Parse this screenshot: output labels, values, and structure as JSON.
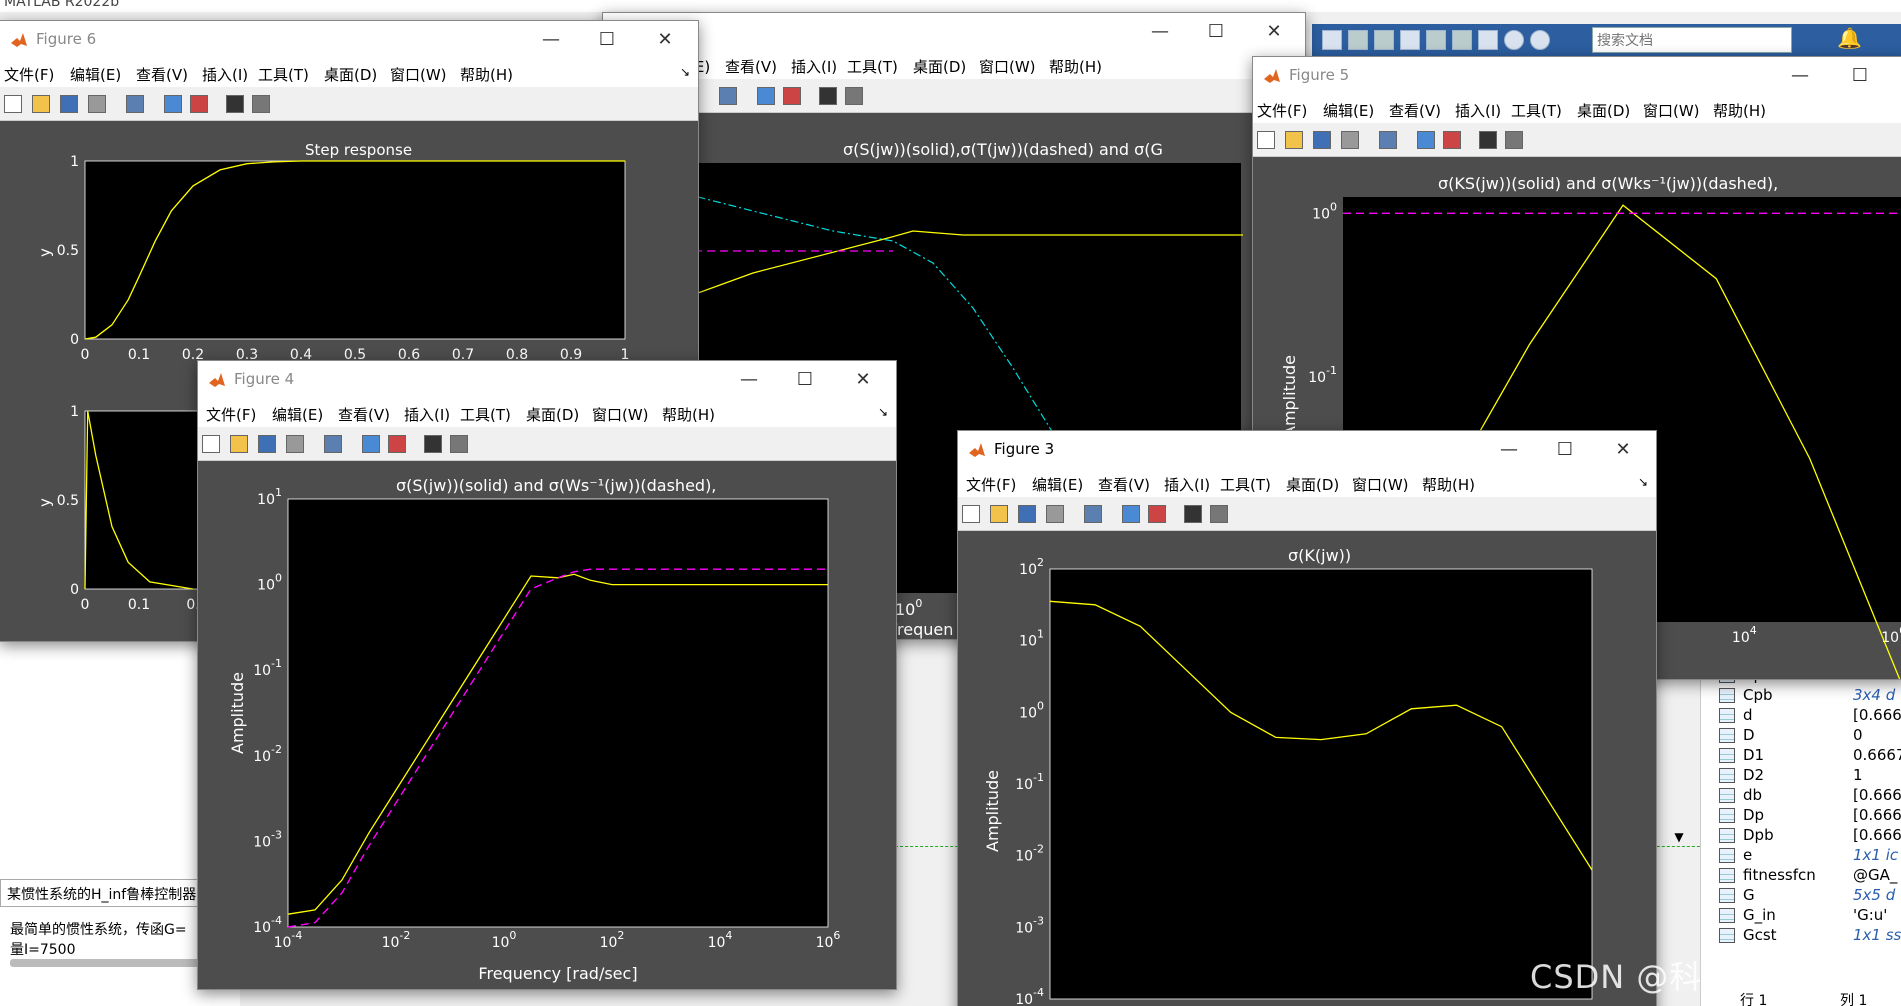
{
  "app": {
    "title": "MATLAB R2022b"
  },
  "toolstrip": {
    "search_placeholder": "搜索文档"
  },
  "menus": [
    "文件(F)",
    "编辑(E)",
    "查看(V)",
    "插入(I)",
    "工具(T)",
    "桌面(D)",
    "窗口(W)",
    "帮助(H)"
  ],
  "windows": {
    "fig6": {
      "title": "Figure 6"
    },
    "fig_back": {
      "title": "",
      "plot_title": "σ(S(jw))(solid),σ(T(jw))(dashed) and σ(G"
    },
    "fig5": {
      "title": "Figure 5",
      "plot_title": "σ(KS(jw))(solid) and σ(Wks⁻¹(jw))(dashed),"
    },
    "fig4": {
      "title": "Figure 4",
      "plot_title": "σ(S(jw))(solid) and σ(Ws⁻¹(jw))(dashed),"
    },
    "fig3": {
      "title": "Figure 3",
      "plot_title": "σ(K(jw))"
    }
  },
  "command_window": {
    "title_line": "某惯性系统的H_inf鲁棒控制器",
    "line1": "最简单的惯性系统，传函G=",
    "line2": "量I=7500"
  },
  "workspace": {
    "rows": [
      {
        "name": "Cp",
        "value": "3x4 d",
        "italic": true
      },
      {
        "name": "Cpb",
        "value": "3x4 d",
        "italic": true
      },
      {
        "name": "d",
        "value": "[0.666",
        "italic": false
      },
      {
        "name": "D",
        "value": "0",
        "italic": false
      },
      {
        "name": "D1",
        "value": "0.6667",
        "italic": false
      },
      {
        "name": "D2",
        "value": "1",
        "italic": false
      },
      {
        "name": "db",
        "value": "[0.666",
        "italic": false
      },
      {
        "name": "Dp",
        "value": "[0.666",
        "italic": false
      },
      {
        "name": "Dpb",
        "value": "[0.666",
        "italic": false
      },
      {
        "name": "e",
        "value": "1x1 ic",
        "italic": true
      },
      {
        "name": "fitnessfcn",
        "value": "@GA_",
        "italic": false
      },
      {
        "name": "G",
        "value": "5x5 d",
        "italic": true
      },
      {
        "name": "G_in",
        "value": "'G:u'",
        "italic": false
      },
      {
        "name": "Gcst",
        "value": "1x1 ss",
        "italic": true
      }
    ]
  },
  "status": {
    "row": "行 1",
    "col": "列 1"
  },
  "watermark": "CSDN @科研助手栗子",
  "chart_data": [
    {
      "type": "line",
      "title": "Step response",
      "ylabel": "y",
      "xlim": [
        0,
        1
      ],
      "ylim": [
        0,
        1
      ],
      "xticks": [
        "0",
        "0.1",
        "0.2",
        "0.3",
        "0.4",
        "0.5",
        "0.6",
        "0.7",
        "0.8",
        "0.9",
        "1"
      ],
      "yticks": [
        "0",
        "0.5",
        "1"
      ],
      "series": [
        {
          "x": [
            0,
            0.02,
            0.05,
            0.08,
            0.1,
            0.13,
            0.16,
            0.2,
            0.25,
            0.3,
            0.35,
            0.4,
            0.5,
            1
          ],
          "values": [
            0,
            0.01,
            0.08,
            0.22,
            0.35,
            0.55,
            0.72,
            0.86,
            0.95,
            0.985,
            0.995,
            1,
            1,
            1
          ]
        }
      ]
    },
    {
      "type": "line",
      "ylabel": "y",
      "xticks": [
        "0",
        "0.1",
        "0."
      ],
      "yticks": [
        "0",
        "0.5",
        "1"
      ],
      "series": [
        {
          "x": [
            0,
            0.005,
            0.02,
            0.05,
            0.08,
            0.12,
            0.2
          ],
          "values": [
            0,
            1,
            0.75,
            0.35,
            0.15,
            0.04,
            0
          ]
        }
      ]
    },
    {
      "type": "line",
      "title": "σ(S(jw))(solid) and σ(Ws⁻¹(jw))(dashed),",
      "xlabel": "Frequency [rad/sec]",
      "ylabel": "Amplitude",
      "xscale": "log",
      "yscale": "log",
      "xticks": [
        "10-4",
        "10-2",
        "100",
        "102",
        "104",
        "106"
      ],
      "yticks": [
        "10-4",
        "10-3",
        "10-2",
        "10-1",
        "100",
        "101"
      ],
      "series": [
        {
          "x": [
            -4,
            -3.5,
            -3,
            -2.5,
            -2,
            -1.5,
            -1,
            -0.5,
            0,
            0.5,
            1,
            1.3,
            1.6,
            2,
            3,
            6
          ],
          "values": [
            -3.85,
            -3.8,
            -3.45,
            -2.9,
            -2.4,
            -1.9,
            -1.4,
            -0.9,
            -0.4,
            0.1,
            0.08,
            0.12,
            0.05,
            0,
            0,
            0
          ]
        },
        {
          "x": [
            -4,
            -3.5,
            -3,
            -2.5,
            -2,
            -1.5,
            -1,
            -0.5,
            0,
            0.5,
            1,
            1.3,
            1.6,
            2,
            3,
            6
          ],
          "values": [
            -4,
            -3.95,
            -3.6,
            -3.05,
            -2.55,
            -2.05,
            -1.55,
            -1.05,
            -0.55,
            -0.05,
            0.08,
            0.15,
            0.18,
            0.18,
            0.18,
            0.18
          ]
        }
      ]
    },
    {
      "type": "line",
      "title": "σ(K(jw))",
      "ylabel": "Amplitude",
      "xscale": "log",
      "yscale": "log",
      "yticks": [
        "10-4",
        "10-3",
        "10-2",
        "10-1",
        "100",
        "101",
        "102"
      ],
      "series": [
        {
          "x": [
            0,
            1,
            2,
            3,
            4,
            5,
            6,
            7,
            8,
            9,
            10,
            11,
            12
          ],
          "values": [
            1.55,
            1.5,
            1.2,
            0.6,
            0,
            -0.35,
            -0.38,
            -0.3,
            0.05,
            0.1,
            -0.2,
            -1.2,
            -2.2
          ]
        }
      ]
    },
    {
      "type": "line",
      "title": "σ(KS(jw))(solid) and σ(Wks⁻¹(jw))(dashed),",
      "ylabel": "Amplitude",
      "xscale": "log",
      "yscale": "log",
      "xticks": [
        "102",
        "104",
        "106"
      ],
      "yticks": [
        "10-2",
        "10-1",
        "100"
      ],
      "series": [
        {
          "x": [
            0,
            1,
            2,
            3,
            4,
            5,
            6
          ],
          "values": [
            -2.3,
            -1.8,
            -0.8,
            0.05,
            -0.4,
            -1.5,
            -2.9
          ]
        },
        {
          "x": [
            0,
            6
          ],
          "values": [
            0,
            0
          ]
        }
      ]
    },
    {
      "type": "line",
      "title": "σ(S(jw))(solid),σ(T(jw))(dashed) and σ(G",
      "xticks": [
        "100"
      ],
      "xlabel": "Frequen",
      "series": [
        {
          "x": [
            0,
            1,
            2,
            3,
            4,
            5
          ],
          "values": [
            -1.5,
            -1.3,
            -0.8,
            -0.2,
            0,
            0
          ]
        },
        {
          "x": [
            0,
            2.5,
            5
          ],
          "values": [
            -0.35,
            -0.35,
            -0.35
          ]
        },
        {
          "x": [
            0,
            1,
            2,
            3,
            4,
            5
          ],
          "values": [
            0.3,
            0.1,
            -0.1,
            -0.4,
            -1.2,
            -2.8
          ]
        }
      ]
    }
  ]
}
